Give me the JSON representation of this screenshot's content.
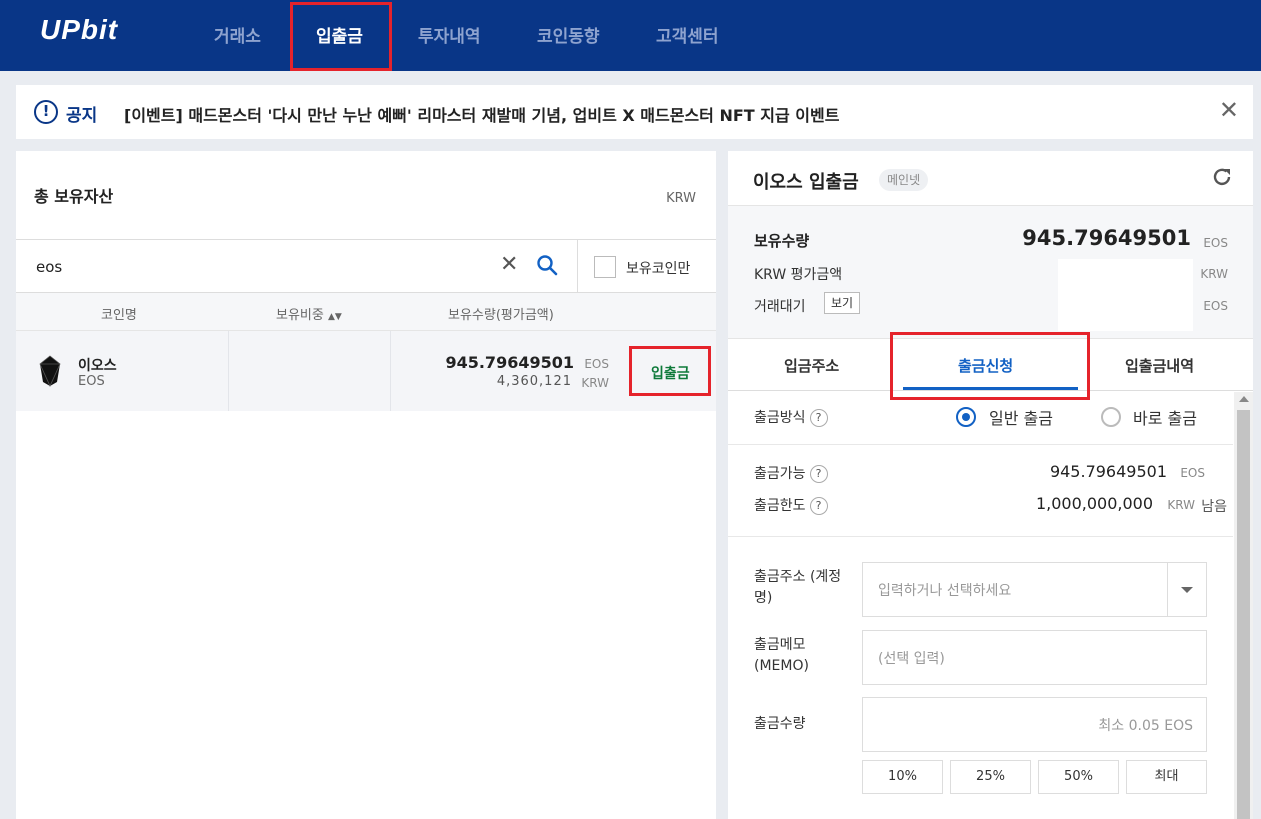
{
  "header": {
    "logo": "UPbit",
    "nav": [
      "거래소",
      "입출금",
      "투자내역",
      "코인동향",
      "고객센터"
    ]
  },
  "notice": {
    "label": "공지",
    "text": "[이벤트] 매드몬스터 '다시 만난 누난 예뻐' 리마스터 재발매 기념, 업비트 X 매드몬스터 NFT 지급 이벤트"
  },
  "left": {
    "title": "총 보유자산",
    "unit": "KRW",
    "search_value": "eos",
    "only_held_label": "보유코인만",
    "columns": [
      "코인명",
      "보유비중",
      "보유수량(평가금액)"
    ],
    "sort_icon": "sort-icon",
    "row": {
      "name": "이오스",
      "symbol": "EOS",
      "quantity": "945.79649501",
      "quantity_unit": "EOS",
      "krw_value": "4,360,121",
      "krw_unit": "KRW",
      "action": "입출금"
    }
  },
  "right": {
    "title": "이오스 입출금",
    "badge": "메인넷",
    "balance": {
      "held_label": "보유수량",
      "held_value": "945.79649501",
      "held_unit": "EOS",
      "krw_label": "KRW 평가금액",
      "krw_unit": "KRW",
      "pending_label": "거래대기",
      "view_label": "보기",
      "pending_unit": "EOS"
    },
    "tabs": [
      "입금주소",
      "출금신청",
      "입출금내역"
    ],
    "form": {
      "method_label": "출금방식",
      "method_options": [
        "일반 출금",
        "바로 출금"
      ],
      "available_label": "출금가능",
      "available_value": "945.79649501",
      "available_unit": "EOS",
      "limit_label": "출금한도",
      "limit_value": "1,000,000,000",
      "limit_unit": "KRW",
      "limit_suffix": "남음",
      "address_label_1": "출금주소 (계정",
      "address_label_2": "명)",
      "address_placeholder": "입력하거나 선택하세요",
      "memo_label_1": "출금메모",
      "memo_label_2": "(MEMO)",
      "memo_placeholder": "(선택 입력)",
      "amount_label": "출금수량",
      "amount_placeholder": "최소 0.05 EOS",
      "pct_buttons": [
        "10%",
        "25%",
        "50%",
        "최대"
      ]
    }
  },
  "colors": {
    "header_bg": "#093687",
    "accent_blue": "#1261c4",
    "highlight_red": "#e5232b",
    "action_green": "#0e7a3a"
  }
}
